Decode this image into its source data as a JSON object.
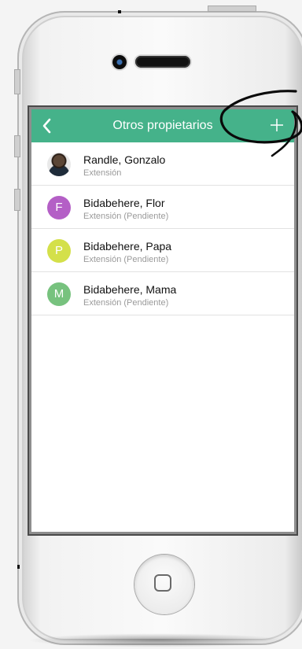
{
  "navbar": {
    "title": "Otros propietarios",
    "back_icon": "chevron-left-icon",
    "add_icon": "plus-icon",
    "color": "#45b28a"
  },
  "owners": [
    {
      "name": "Randle, Gonzalo",
      "status": "Extensión",
      "avatar": "photo"
    },
    {
      "name": "Bidabehere, Flor",
      "status": "Extensión (Pendiente)",
      "initial": "F",
      "color": "#b45fc6"
    },
    {
      "name": "Bidabehere, Papa",
      "status": "Extensión (Pendiente)",
      "initial": "P",
      "color": "#d4e04a"
    },
    {
      "name": "Bidabehere, Mama",
      "status": "Extensión (Pendiente)",
      "initial": "M",
      "color": "#77c27e"
    }
  ]
}
